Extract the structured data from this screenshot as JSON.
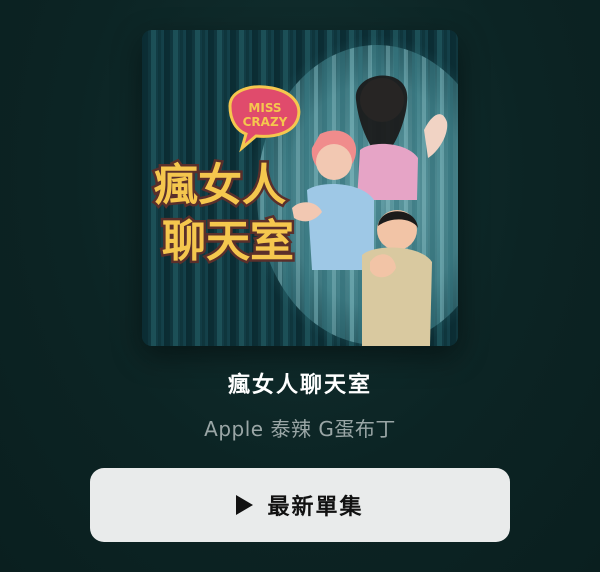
{
  "show": {
    "title": "瘋女人聊天室",
    "author": "Apple 泰辣 G蛋布丁",
    "artwork": {
      "badge_text_1": "MISS",
      "badge_text_2": "CRAZY",
      "title_line_1": "瘋女人",
      "title_line_2": "聊天室"
    }
  },
  "actions": {
    "latest_episode_label": "最新單集",
    "latest_episode_icon": "play-icon"
  },
  "colors": {
    "background": "#0c2323",
    "button_bg": "#e9ebeb",
    "title_text": "#ffffff",
    "author_text": "#9aa6a6",
    "art_title_yellow": "#f5c74e"
  }
}
